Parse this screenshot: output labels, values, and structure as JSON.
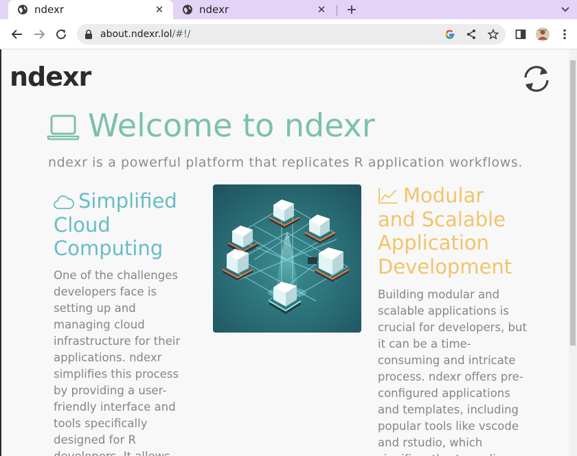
{
  "browser": {
    "tabs": [
      {
        "title": "ndexr",
        "active": true
      },
      {
        "title": "ndexr",
        "active": false
      }
    ],
    "new_tab_icon": "plus-icon",
    "tab_search_icon": "chevron-down-icon",
    "address": {
      "host": "about.ndexr.lol",
      "path": "/#!/"
    },
    "toolbar_icons": [
      "back-arrow-icon",
      "forward-arrow-icon",
      "reload-icon",
      "lock-icon",
      "google-icon",
      "share-icon",
      "star-icon",
      "side-panel-icon",
      "profile-avatar",
      "kebab-menu-icon"
    ]
  },
  "page": {
    "logo": "ndexr",
    "hero": {
      "title": "Welcome to ndexr",
      "subtitle": "ndexr is a powerful platform that replicates R application workflows.",
      "icon": "laptop-icon"
    },
    "features": [
      {
        "title": "Simplified Cloud Computing",
        "icon": "cloud-icon",
        "color": "#67bcc7",
        "body": "One of the challenges developers face is setting up and managing cloud infrastructure for their applications. ndexr simplifies this process by providing a user-friendly interface and tools specifically designed for R developers. It allows"
      },
      {
        "title": "Modular and Scalable Application Development",
        "icon": "line-chart-icon",
        "color": "#f2c36b",
        "body": "Building modular and scalable applications is crucial for developers, but it can be a time-consuming and intricate process. ndexr offers pre-configured applications and templates, including popular tools like vscode and rstudio, which significantly streamline"
      }
    ],
    "illustration_icon": "server-network-illustration",
    "colors": {
      "tab_strip": "#e3d3f7",
      "hero": "#7cc1a9",
      "teal": "#67bcc7",
      "gold": "#f2c36b",
      "illustration_bg": "#27646c"
    }
  }
}
